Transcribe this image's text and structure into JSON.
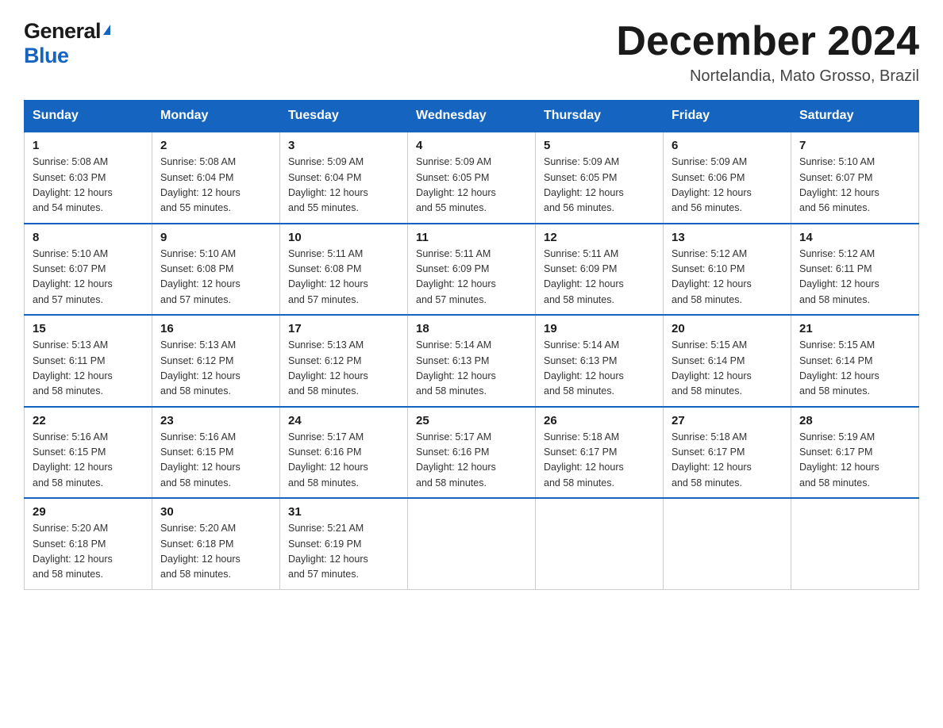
{
  "header": {
    "logo_general": "General",
    "logo_blue": "Blue",
    "month_title": "December 2024",
    "location": "Nortelandia, Mato Grosso, Brazil"
  },
  "days_of_week": [
    "Sunday",
    "Monday",
    "Tuesday",
    "Wednesday",
    "Thursday",
    "Friday",
    "Saturday"
  ],
  "weeks": [
    [
      {
        "day": "1",
        "sunrise": "5:08 AM",
        "sunset": "6:03 PM",
        "daylight": "12 hours and 54 minutes."
      },
      {
        "day": "2",
        "sunrise": "5:08 AM",
        "sunset": "6:04 PM",
        "daylight": "12 hours and 55 minutes."
      },
      {
        "day": "3",
        "sunrise": "5:09 AM",
        "sunset": "6:04 PM",
        "daylight": "12 hours and 55 minutes."
      },
      {
        "day": "4",
        "sunrise": "5:09 AM",
        "sunset": "6:05 PM",
        "daylight": "12 hours and 55 minutes."
      },
      {
        "day": "5",
        "sunrise": "5:09 AM",
        "sunset": "6:05 PM",
        "daylight": "12 hours and 56 minutes."
      },
      {
        "day": "6",
        "sunrise": "5:09 AM",
        "sunset": "6:06 PM",
        "daylight": "12 hours and 56 minutes."
      },
      {
        "day": "7",
        "sunrise": "5:10 AM",
        "sunset": "6:07 PM",
        "daylight": "12 hours and 56 minutes."
      }
    ],
    [
      {
        "day": "8",
        "sunrise": "5:10 AM",
        "sunset": "6:07 PM",
        "daylight": "12 hours and 57 minutes."
      },
      {
        "day": "9",
        "sunrise": "5:10 AM",
        "sunset": "6:08 PM",
        "daylight": "12 hours and 57 minutes."
      },
      {
        "day": "10",
        "sunrise": "5:11 AM",
        "sunset": "6:08 PM",
        "daylight": "12 hours and 57 minutes."
      },
      {
        "day": "11",
        "sunrise": "5:11 AM",
        "sunset": "6:09 PM",
        "daylight": "12 hours and 57 minutes."
      },
      {
        "day": "12",
        "sunrise": "5:11 AM",
        "sunset": "6:09 PM",
        "daylight": "12 hours and 58 minutes."
      },
      {
        "day": "13",
        "sunrise": "5:12 AM",
        "sunset": "6:10 PM",
        "daylight": "12 hours and 58 minutes."
      },
      {
        "day": "14",
        "sunrise": "5:12 AM",
        "sunset": "6:11 PM",
        "daylight": "12 hours and 58 minutes."
      }
    ],
    [
      {
        "day": "15",
        "sunrise": "5:13 AM",
        "sunset": "6:11 PM",
        "daylight": "12 hours and 58 minutes."
      },
      {
        "day": "16",
        "sunrise": "5:13 AM",
        "sunset": "6:12 PM",
        "daylight": "12 hours and 58 minutes."
      },
      {
        "day": "17",
        "sunrise": "5:13 AM",
        "sunset": "6:12 PM",
        "daylight": "12 hours and 58 minutes."
      },
      {
        "day": "18",
        "sunrise": "5:14 AM",
        "sunset": "6:13 PM",
        "daylight": "12 hours and 58 minutes."
      },
      {
        "day": "19",
        "sunrise": "5:14 AM",
        "sunset": "6:13 PM",
        "daylight": "12 hours and 58 minutes."
      },
      {
        "day": "20",
        "sunrise": "5:15 AM",
        "sunset": "6:14 PM",
        "daylight": "12 hours and 58 minutes."
      },
      {
        "day": "21",
        "sunrise": "5:15 AM",
        "sunset": "6:14 PM",
        "daylight": "12 hours and 58 minutes."
      }
    ],
    [
      {
        "day": "22",
        "sunrise": "5:16 AM",
        "sunset": "6:15 PM",
        "daylight": "12 hours and 58 minutes."
      },
      {
        "day": "23",
        "sunrise": "5:16 AM",
        "sunset": "6:15 PM",
        "daylight": "12 hours and 58 minutes."
      },
      {
        "day": "24",
        "sunrise": "5:17 AM",
        "sunset": "6:16 PM",
        "daylight": "12 hours and 58 minutes."
      },
      {
        "day": "25",
        "sunrise": "5:17 AM",
        "sunset": "6:16 PM",
        "daylight": "12 hours and 58 minutes."
      },
      {
        "day": "26",
        "sunrise": "5:18 AM",
        "sunset": "6:17 PM",
        "daylight": "12 hours and 58 minutes."
      },
      {
        "day": "27",
        "sunrise": "5:18 AM",
        "sunset": "6:17 PM",
        "daylight": "12 hours and 58 minutes."
      },
      {
        "day": "28",
        "sunrise": "5:19 AM",
        "sunset": "6:17 PM",
        "daylight": "12 hours and 58 minutes."
      }
    ],
    [
      {
        "day": "29",
        "sunrise": "5:20 AM",
        "sunset": "6:18 PM",
        "daylight": "12 hours and 58 minutes."
      },
      {
        "day": "30",
        "sunrise": "5:20 AM",
        "sunset": "6:18 PM",
        "daylight": "12 hours and 58 minutes."
      },
      {
        "day": "31",
        "sunrise": "5:21 AM",
        "sunset": "6:19 PM",
        "daylight": "12 hours and 57 minutes."
      },
      null,
      null,
      null,
      null
    ]
  ],
  "labels": {
    "sunrise": "Sunrise:",
    "sunset": "Sunset:",
    "daylight": "Daylight:"
  }
}
